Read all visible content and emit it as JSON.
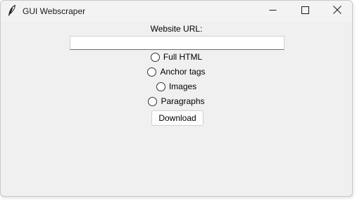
{
  "window": {
    "title": "GUI Webscraper",
    "icon": "feather-icon"
  },
  "controls": {
    "minimize_icon": "minimize-icon",
    "maximize_icon": "maximize-icon",
    "close_icon": "close-icon"
  },
  "form": {
    "url_label": "Website URL:",
    "url_value": "",
    "url_placeholder": "",
    "options": [
      {
        "label": "Full HTML",
        "selected": false
      },
      {
        "label": "Anchor tags",
        "selected": false
      },
      {
        "label": "Images",
        "selected": false
      },
      {
        "label": "Paragraphs",
        "selected": false
      }
    ],
    "download_label": "Download"
  },
  "colors": {
    "window_bg": "#f0f0f0",
    "titlebar_bg": "#f3f3f3",
    "input_bg": "#ffffff"
  }
}
